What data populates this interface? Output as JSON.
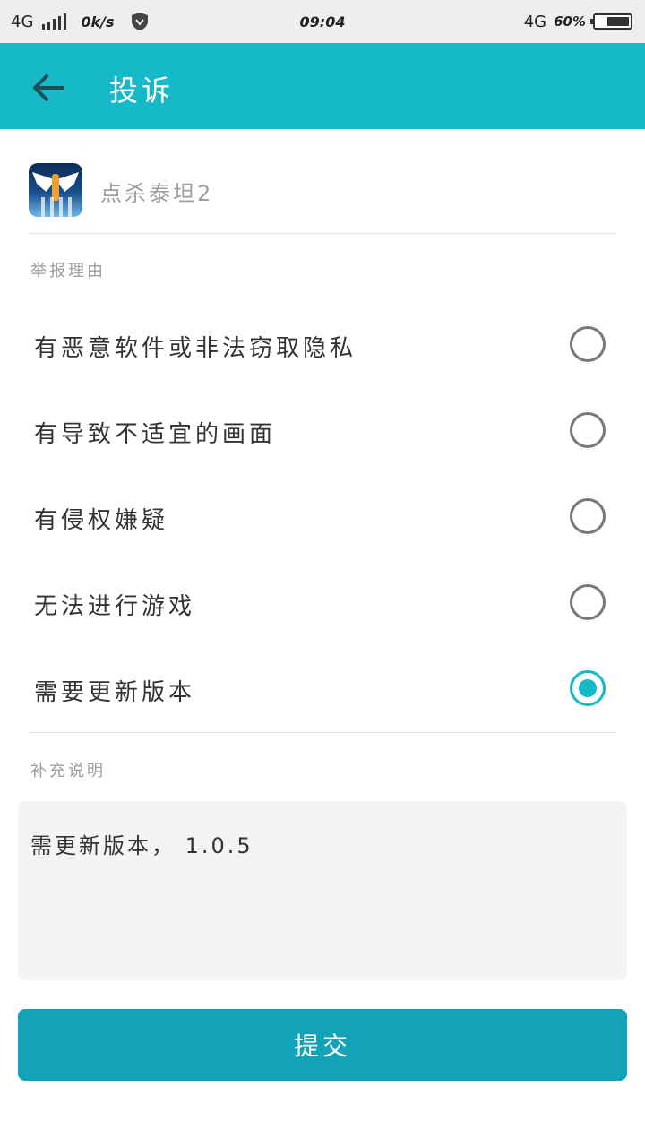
{
  "status_bar": {
    "network": "4G",
    "speed": "0k/s",
    "time": "09:04",
    "network_right": "4G",
    "battery": "60%"
  },
  "toolbar": {
    "back_icon": "arrow-left-icon",
    "title": "投诉"
  },
  "app": {
    "name": "点杀泰坦2"
  },
  "reasons": {
    "label": "举报理由",
    "options": [
      {
        "label": "有恶意软件或非法窃取隐私",
        "checked": false
      },
      {
        "label": "有导致不适宜的画面",
        "checked": false
      },
      {
        "label": "有侵权嫌疑",
        "checked": false
      },
      {
        "label": "无法进行游戏",
        "checked": false
      },
      {
        "label": "需要更新版本",
        "checked": true
      }
    ]
  },
  "supplement": {
    "label": "补充说明",
    "value": "需更新版本， 1.0.5"
  },
  "submit_label": "提交",
  "colors": {
    "accent": "#15b9c8",
    "button": "#12a4b6"
  }
}
